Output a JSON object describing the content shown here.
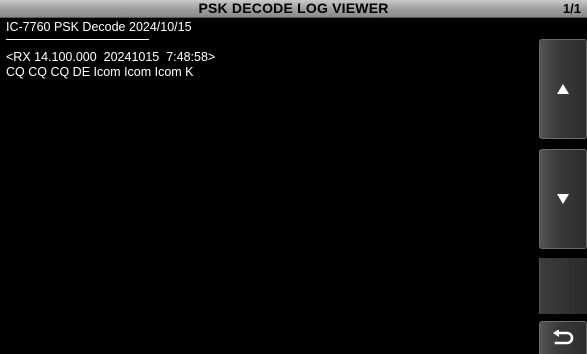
{
  "window": {
    "title": "PSK DECODE LOG VIEWER",
    "page_indicator": "1/1"
  },
  "log": {
    "header": "IC-7760 PSK Decode 2024/10/15",
    "entries": [
      {
        "rx_line": "<RX 14.100.000  20241015  7:48:58>",
        "message": "CQ CQ CQ DE Icom Icom Icom K"
      }
    ]
  },
  "sidebar": {
    "up_button": "arrow-up-icon",
    "down_button": "arrow-down-icon",
    "back_button": "return-icon"
  }
}
